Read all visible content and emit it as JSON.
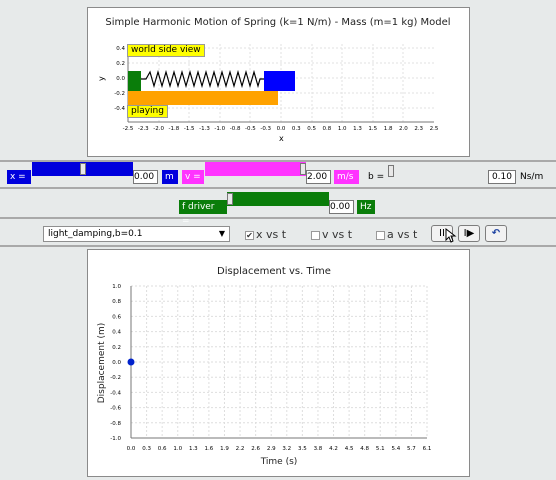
{
  "colors": {
    "blue": "#0000dd",
    "magenta": "#ff33ff",
    "green": "#0a7d0a",
    "orange": "#ffa200",
    "yellow": "#ffff00"
  },
  "sim": {
    "title": "Simple Harmonic Motion of Spring (k=1 N/m) - Mass (m=1 kg) Model",
    "view_label": "world side view",
    "status_label": "playing",
    "x_axis_label": "x",
    "y_axis_label": "y",
    "x_ticks": [
      "-2.5",
      "-2.3",
      "-2.0",
      "-1.8",
      "-1.5",
      "-1.3",
      "-1.0",
      "-0.8",
      "-0.5",
      "-0.3",
      "0.0",
      "0.3",
      "0.5",
      "0.8",
      "1.0",
      "1.3",
      "1.5",
      "1.8",
      "2.0",
      "2.3",
      "2.5"
    ],
    "y_ticks": [
      "0.4",
      "0.2",
      "0.0",
      "-0.2",
      "-0.4"
    ]
  },
  "controls": {
    "x_label": "x =",
    "x_value": "0.00",
    "x_unit": "m",
    "x_level": 0.5,
    "v_label": "v =",
    "v_value": "2.00",
    "v_unit": "m/s",
    "v_level": 1.0,
    "b_label": "b =",
    "b_value": "0.10",
    "b_unit": "Ns/m",
    "b_level": 0.0,
    "fdriver_label": "f driver =",
    "fdriver_value": "0.00",
    "fdriver_unit": "Hz",
    "fdriver_level": 0.0
  },
  "toolbar": {
    "preset_selected": "light_damping,b=0.1",
    "preset_arrow": "▼",
    "cb_x": "x vs t",
    "cb_v": "v vs t",
    "cb_a": "a vs t",
    "check_mark": "✔",
    "pause_symbol": "II",
    "step_symbol": "I▶",
    "reset_symbol": "↶"
  },
  "chart_data": {
    "type": "scatter",
    "title": "Displacement vs. Time",
    "xlabel": "Time (s)",
    "ylabel": "Displacement (m)",
    "xlim": [
      0.0,
      6.1
    ],
    "ylim": [
      -1.0,
      1.0
    ],
    "x_ticks": [
      "0.0",
      "0.3",
      "0.6",
      "1.0",
      "1.3",
      "1.6",
      "1.9",
      "2.2",
      "2.6",
      "2.9",
      "3.2",
      "3.5",
      "3.8",
      "4.2",
      "4.5",
      "4.8",
      "5.1",
      "5.4",
      "5.7",
      "6.1"
    ],
    "y_ticks": [
      "1.0",
      "0.8",
      "0.6",
      "0.4",
      "0.2",
      "0.0",
      "-0.2",
      "-0.4",
      "-0.6",
      "-0.8",
      "-1.0"
    ],
    "grid": true,
    "series": [
      {
        "values": [
          {
            "x": 0.0,
            "y": 0.0
          }
        ]
      }
    ]
  }
}
